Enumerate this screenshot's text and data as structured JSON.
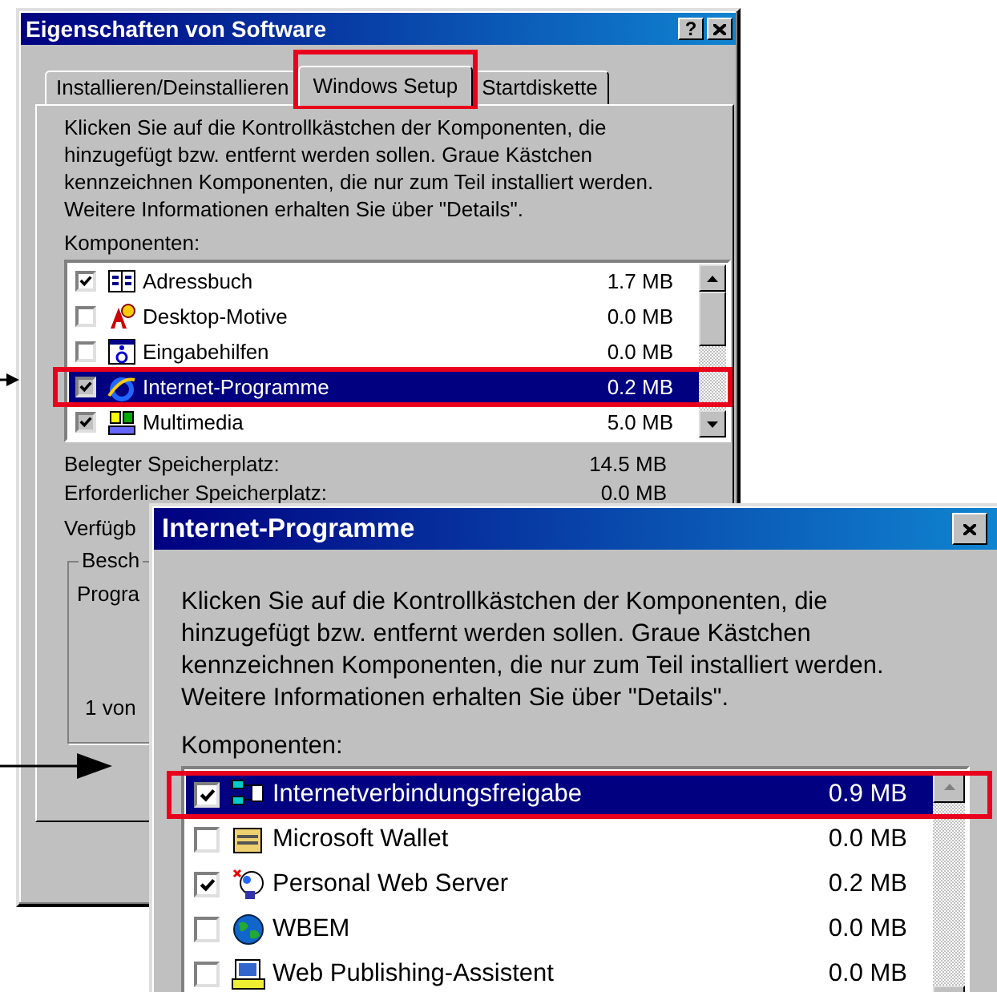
{
  "software_dialog": {
    "title": "Eigenschaften von Software",
    "help_button": "?",
    "tabs": [
      {
        "label": "Installieren/Deinstallieren",
        "selected": false
      },
      {
        "label": "Windows Setup",
        "selected": true
      },
      {
        "label": "Startdiskette",
        "selected": false
      }
    ],
    "description": "Klicken Sie auf die Kontrollkästchen der Komponenten, die hinzugefügt bzw. entfernt werden sollen. Graue Kästchen kennzeichnen Komponenten, die nur zum Teil installiert werden. Weitere Informationen erhalten Sie über \"Details\".",
    "components_label": "Komponenten:",
    "components": [
      {
        "name": "Adressbuch",
        "size": "1.7 MB",
        "checked": true,
        "partial": false,
        "selected": false
      },
      {
        "name": "Desktop-Motive",
        "size": "0.0 MB",
        "checked": false,
        "partial": false,
        "selected": false
      },
      {
        "name": "Eingabehilfen",
        "size": "0.0 MB",
        "checked": false,
        "partial": false,
        "selected": false
      },
      {
        "name": "Internet-Programme",
        "size": "0.2 MB",
        "checked": true,
        "partial": true,
        "selected": true
      },
      {
        "name": "Multimedia",
        "size": "5.0 MB",
        "checked": true,
        "partial": true,
        "selected": false
      }
    ],
    "space": [
      {
        "label": "Belegter Speicherplatz:",
        "value": "14.5 MB"
      },
      {
        "label": "Erforderlicher Speicherplatz:",
        "value": "0.0 MB"
      },
      {
        "label": "Verfügb"
      }
    ],
    "group": {
      "title": "Besch",
      "lines": [
        "Progra",
        "1 von"
      ]
    }
  },
  "internet_dialog": {
    "title": "Internet-Programme",
    "description": "Klicken Sie auf die Kontrollkästchen der Komponenten, die hinzugefügt bzw. entfernt werden sollen. Graue Kästchen kennzeichnen Komponenten, die nur zum Teil installiert werden. Weitere Informationen erhalten Sie über \"Details\".",
    "components_label": "Komponenten:",
    "components": [
      {
        "name": "Internetverbindungsfreigabe",
        "size": "0.9 MB",
        "checked": true,
        "partial": false,
        "selected": true
      },
      {
        "name": "Microsoft Wallet",
        "size": "0.0 MB",
        "checked": false,
        "partial": false,
        "selected": false
      },
      {
        "name": "Personal Web Server",
        "size": "0.2 MB",
        "checked": true,
        "partial": false,
        "selected": false
      },
      {
        "name": "WBEM",
        "size": "0.0 MB",
        "checked": false,
        "partial": false,
        "selected": false
      },
      {
        "name": "Web Publishing-Assistent",
        "size": "0.0 MB",
        "checked": false,
        "partial": false,
        "selected": false
      }
    ]
  }
}
